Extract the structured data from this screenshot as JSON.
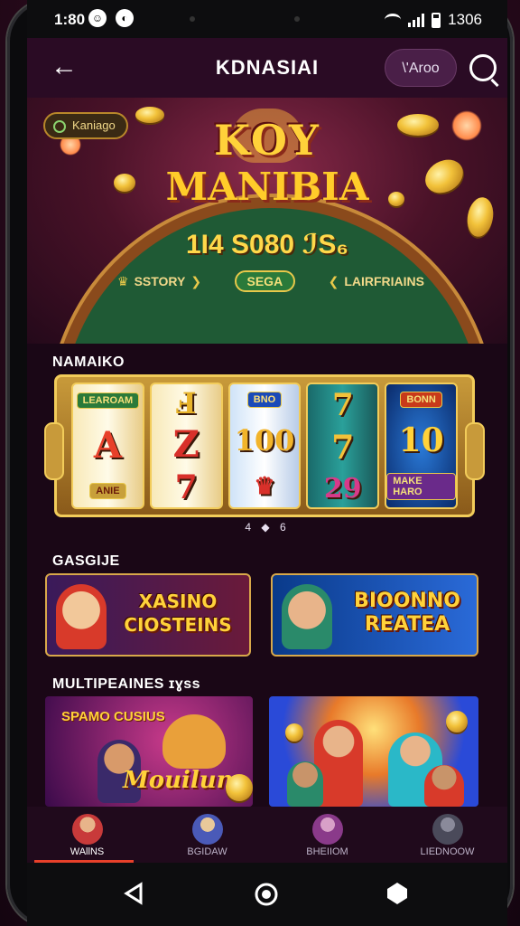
{
  "status": {
    "time": "1:80",
    "right_text": "1306"
  },
  "header": {
    "back": "←",
    "title": "KDNASIAI",
    "pill": "\\'Aroo"
  },
  "hero": {
    "tag": "Kaniago",
    "logo_top": "KOY",
    "logo_bottom": "MANIBIA",
    "jackpot": "1Ӏ4 S080 ℐS₆",
    "link_left": "SSTORY",
    "link_mid": "SEGA",
    "link_right": "LAIRFRIAINS"
  },
  "sections": {
    "slots_title": "NAMAIKO",
    "cards_title": "GASGIJE",
    "multi_title": "MULTIPEAINES ɪɣss"
  },
  "slots": {
    "reel1": [
      "",
      "A",
      ""
    ],
    "reel1_labels": [
      "LEAROAM",
      "ANIE"
    ],
    "reel2": [
      "Ⅎ",
      "Z",
      "7"
    ],
    "reel3_label": "BNO",
    "reel3": [
      "100"
    ],
    "reel4": [
      "7",
      "7",
      "29"
    ],
    "reel5_labels": [
      "BONN",
      "MAKE HARO"
    ],
    "reel5": [
      "10"
    ],
    "pager": "4 ◆ 6"
  },
  "cards": {
    "card1": "XASINO CIOSTEINS",
    "card2": "BIOONNO REATEA"
  },
  "multi": {
    "tile1_top": "SPAMO CUSIUS",
    "tile1_script": "Mouilum"
  },
  "nav": {
    "items": [
      "WAllNS",
      "BGIDAW",
      "BHEIIOM",
      "LIEDNOOW"
    ],
    "active_index": 0
  },
  "colors": {
    "accent": "#e8402a",
    "gold": "#ffd23a",
    "bg": "#1a0716"
  }
}
